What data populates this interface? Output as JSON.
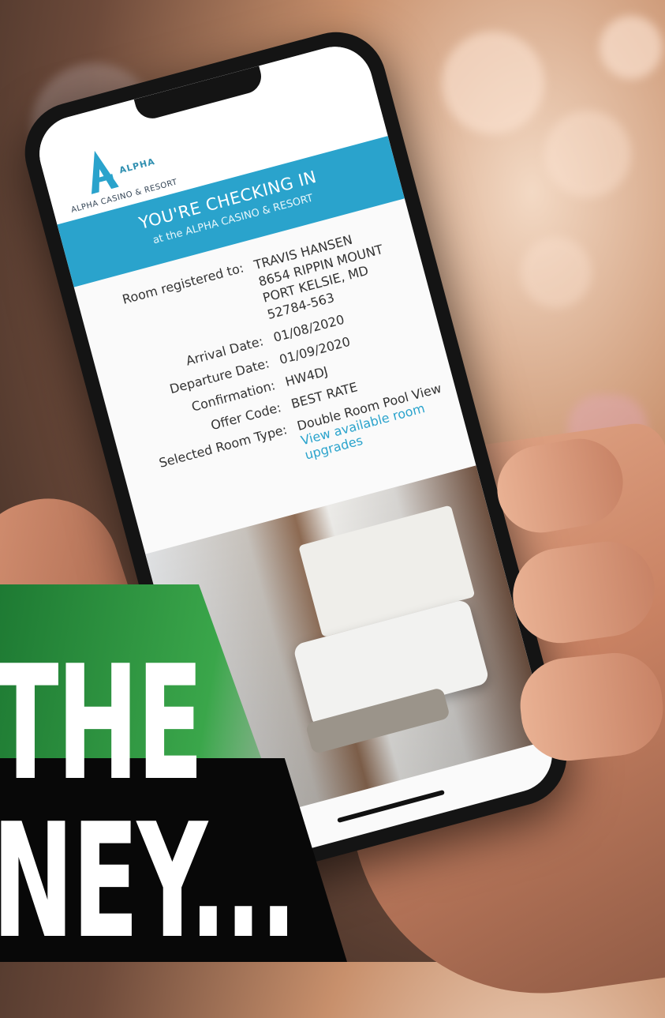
{
  "brand": {
    "logo_letter": "A",
    "logo_word": "ALPHA",
    "logo_sub": "ALPHA CASINO & RESORT",
    "accent": "#2aa3cc"
  },
  "banner": {
    "title": "YOU'RE CHECKING IN",
    "subtitle": "at the ALPHA CASINO & RESORT"
  },
  "details": {
    "registered_label": "Room registered to:",
    "registered_name": "TRAVIS HANSEN",
    "registered_address": "8654 RIPPIN MOUNT PORT KELSIE, MD 52784-563",
    "arrival_label": "Arrival Date:",
    "arrival_value": "01/08/2020",
    "departure_label": "Departure Date:",
    "departure_value": "01/09/2020",
    "confirmation_label": "Confirmation:",
    "confirmation_value": "HW4DJ",
    "offer_label": "Offer Code:",
    "offer_value": "BEST RATE",
    "room_type_label": "Selected Room Type:",
    "room_type_value": "Double Room Pool View",
    "upgrade_link": "View available room upgrades"
  },
  "overlay": {
    "line1": "THE",
    "line2": "NEY..."
  }
}
